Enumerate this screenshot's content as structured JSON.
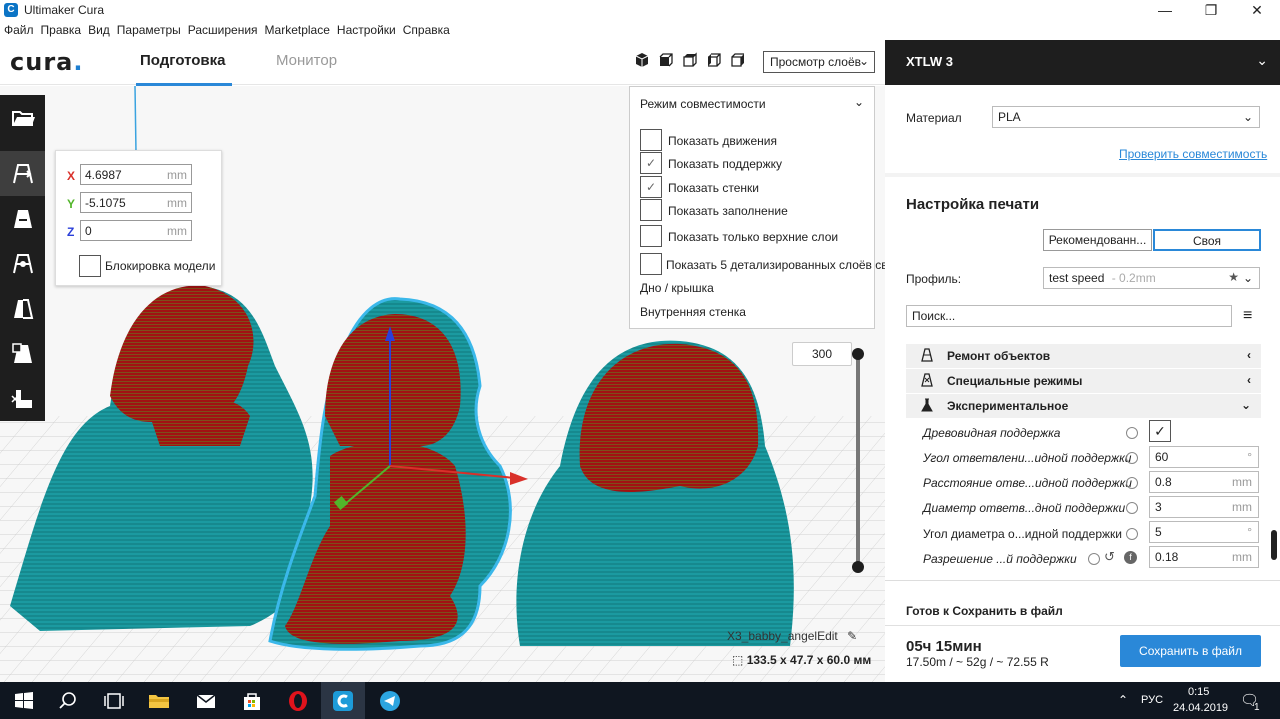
{
  "window": {
    "title": "Ultimaker Cura",
    "controls": {
      "minimize": "—",
      "maximize": "❐",
      "close": "✕"
    }
  },
  "menu": [
    "Файл",
    "Правка",
    "Вид",
    "Параметры",
    "Расширения",
    "Marketplace",
    "Настройки",
    "Справка"
  ],
  "header": {
    "logo": "cura",
    "logo_dot": ".",
    "tabs": {
      "prepare": "Подготовка",
      "monitor": "Монитор"
    },
    "view_select": "Просмотр слоёв",
    "view_icons": [
      "3d-view-icon",
      "front-view-icon",
      "top-view-icon",
      "left-view-icon",
      "right-view-icon"
    ]
  },
  "move_panel": {
    "x_label": "X",
    "x_value": "4.6987",
    "y_label": "Y",
    "y_value": "-5.1075",
    "z_label": "Z",
    "z_value": "0",
    "unit": "mm",
    "lock_label": "Блокировка модели",
    "axis_colors": {
      "x": "#d9302a",
      "y": "#52b52a",
      "z": "#2a3fd9"
    }
  },
  "compat": {
    "header": "Режим совместимости",
    "rows": [
      {
        "label": "Показать движения",
        "checked": false
      },
      {
        "label": "Показать поддержку",
        "checked": true
      },
      {
        "label": "Показать стенки",
        "checked": true
      },
      {
        "label": "Показать заполнение",
        "checked": false
      },
      {
        "label": "Показать только верхние слои",
        "checked": false
      },
      {
        "label": "Показать 5 детализированных слоёв св",
        "checked": false
      }
    ],
    "legend": [
      "Дно / крышка",
      "Внутренняя стенка"
    ]
  },
  "slider": {
    "value": "300"
  },
  "object": {
    "name": "X3_babby_angelEdit",
    "dims": "133.5 x 47.7 x 60.0 мм"
  },
  "right_panel": {
    "printer": "XTLW 3",
    "material_label": "Материал",
    "material_value": "PLA",
    "compat_link": "Проверить совместимость",
    "print_setup_title": "Настройка печати",
    "mode_recommended": "Рекомендованн...",
    "mode_custom": "Своя",
    "profile_label": "Профиль:",
    "profile_value": "test speed",
    "profile_layer": "- 0.2mm",
    "search_placeholder": "Поиск...",
    "categories": [
      {
        "label": "Ремонт объектов",
        "chev": "‹"
      },
      {
        "label": "Специальные режимы",
        "chev": "‹"
      },
      {
        "label": "Экспериментальное",
        "chev": "⌄"
      }
    ],
    "settings": [
      {
        "label": "Древовидная поддержка",
        "value": "✓",
        "unit": ""
      },
      {
        "label": "Угол ответвлени...идной поддержки",
        "value": "60",
        "unit": "°"
      },
      {
        "label": "Расстояние отве...идной поддержки",
        "value": "0.8",
        "unit": "mm"
      },
      {
        "label": "Диаметр ответв...дной поддержки",
        "value": "3",
        "unit": "mm"
      },
      {
        "label": "Угол диаметра о...идной поддержки",
        "value": "5",
        "unit": "°"
      },
      {
        "label": "Разрешение ...й поддержки",
        "value": "0.18",
        "unit": "mm"
      }
    ]
  },
  "bottom": {
    "ready": "Готов к Сохранить в файл",
    "time": "05ч 15мин",
    "stats": "17.50m / ~ 52g / ~ 72.55 R",
    "save_button": "Сохранить в файл"
  },
  "taskbar": {
    "language": "РУС",
    "time": "0:15",
    "date": "24.04.2019",
    "notifications": "1"
  },
  "colors": {
    "accent": "#2a88d8",
    "support": "#1ba3a8",
    "walls": "#a01010",
    "dark": "#1e1e1e"
  }
}
